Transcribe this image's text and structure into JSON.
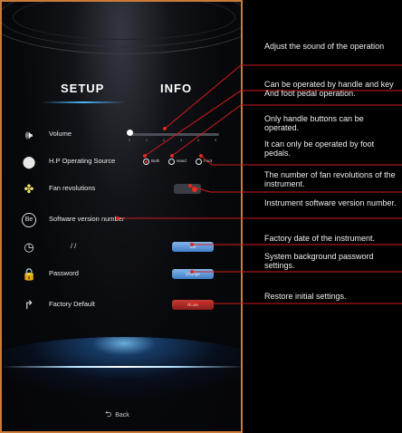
{
  "tabs": {
    "setup": "SETUP",
    "info": "INFO"
  },
  "settings": {
    "volume": {
      "label": "Volume",
      "level": 0,
      "ticks": [
        "0",
        "1",
        "2",
        "3",
        "4",
        "5"
      ]
    },
    "operating_source": {
      "label": "H.P Operating Source",
      "options": [
        "Both",
        "Hand",
        "Foot"
      ],
      "selected": "Both"
    },
    "fan": {
      "label": "Fan revolutions"
    },
    "software": {
      "label": "Software version number"
    },
    "date": {
      "value": "/    /",
      "button": "Set"
    },
    "password": {
      "label": "Password",
      "button": "Change"
    },
    "factory": {
      "label": "Factory Default",
      "button": "Reset"
    }
  },
  "back_label": "Back",
  "annotations": [
    "Adjust the sound of the operation",
    "Can be operated by handle and key And foot pedal operation.",
    "Only handle buttons can be operated.",
    "It can only be operated by foot pedals.",
    "The number of fan revolutions of the instrument.",
    "Instrument software version number.",
    "Factory date of the instrument.",
    "System background password settings.",
    "Restore initial settings."
  ],
  "colors": {
    "border": "#c87a3a",
    "annotation_line": "#d01c1c",
    "accent_blue": "#4ab8ff"
  },
  "icons": [
    "speaker-icon",
    "handpiece-icon",
    "fan-icon",
    "version-icon",
    "clock-icon",
    "lock-icon",
    "reset-arrow-icon",
    "back-arrow-icon"
  ]
}
